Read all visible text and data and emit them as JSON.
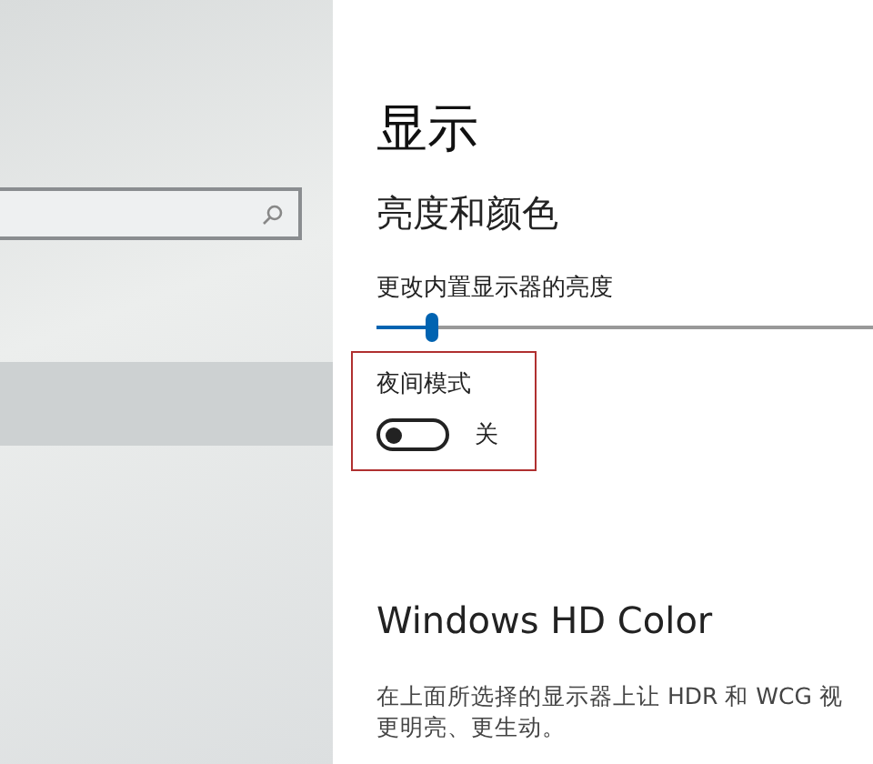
{
  "sidebar": {
    "items": [
      {
        "selected": true
      }
    ]
  },
  "page": {
    "title": "显示",
    "section": "亮度和颜色",
    "brightness": {
      "label": "更改内置显示器的亮度",
      "level": 0.1
    },
    "night_mode": {
      "label": "夜间模式",
      "on": false,
      "state_text": "关",
      "highlighted": true
    },
    "hd_color": {
      "title": "Windows HD Color",
      "description": "在上面所选择的显示器上让 HDR 和 WCG 视",
      "description_2": "更明亮、更生动。"
    }
  }
}
